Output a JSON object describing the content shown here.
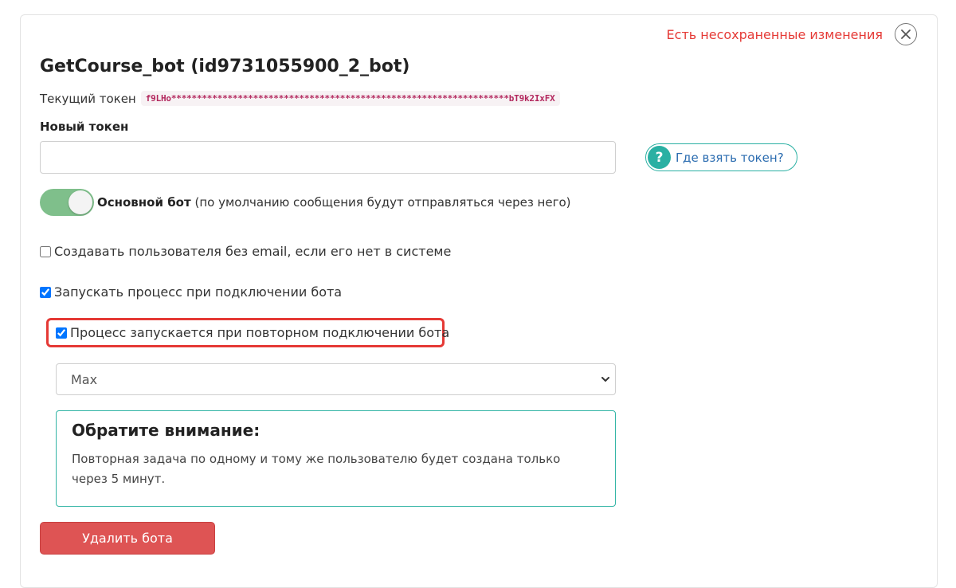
{
  "header": {
    "unsaved_status": "Есть несохраненные изменения",
    "title": "GetCourse_bot (id9731055900_2_bot)"
  },
  "token": {
    "current_label": "Текущий токен",
    "current_value": "f9LHo******************************************************************bT9k2IxFX",
    "new_label": "Новый токен",
    "new_value": "",
    "new_placeholder": ""
  },
  "help": {
    "icon": "?",
    "label": "Где взять токен?"
  },
  "main_bot": {
    "enabled": true,
    "label_bold": "Основной бот",
    "label_rest": "(по умолчанию сообщения будут отправляться через него)"
  },
  "options": [
    {
      "label": "Создавать пользователя без email, если его нет в системе",
      "checked": false
    },
    {
      "label": "Запускать процесс при подключении бота",
      "checked": true
    },
    {
      "label": "Процесс запускается при повторном подключении бота",
      "checked": true
    }
  ],
  "process_select": {
    "selected": "Max"
  },
  "notice": {
    "title": "Обратите внимание:",
    "text": "Повторная задача по одному и тому же пользователю будет создана только через 5 минут."
  },
  "actions": {
    "delete_label": "Удалить бота"
  },
  "colors": {
    "danger": "#de5454",
    "accent": "#2ab0a3",
    "toggle_on": "#7fbf8b",
    "highlight": "#e53935"
  }
}
